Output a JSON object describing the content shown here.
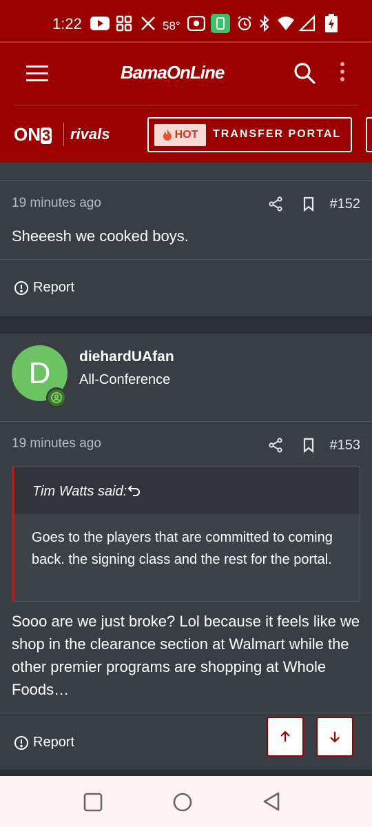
{
  "status_bar": {
    "time": "1:22",
    "temperature": "58°",
    "icons": [
      "youtube-icon",
      "apps-icon",
      "x-icon",
      "hotspot-icon",
      "battery-saver-icon",
      "alarm-icon",
      "bluetooth-icon",
      "wifi-icon",
      "signal-icon",
      "battery-icon"
    ]
  },
  "header": {
    "site_name": "BamaOnLine",
    "on3_label": "ON",
    "on3_digit": "3",
    "rivals_label": "rivals",
    "hot_label": "HOT",
    "transfer_portal_label": "TRANSFER PORTAL",
    "brand_color": "#9b0000"
  },
  "posts": [
    {
      "time": "19 minutes ago",
      "number": "#152",
      "body": "Sheeesh we cooked boys.",
      "report_label": "Report"
    },
    {
      "author": "diehardUAfan",
      "rank": "All-Conference",
      "avatar_letter": "D",
      "avatar_color": "#6dc264",
      "time": "19 minutes ago",
      "number": "#153",
      "quote": {
        "author": "Tim Watts said:",
        "text": "Goes to the players that are committed to coming back. the signing class and the rest for the portal."
      },
      "body": "Sooo are we just broke? Lol because it feels like we shop in the clearance section at Walmart while the other premier programs are shopping at Whole Foods…",
      "report_label": "Report"
    }
  ],
  "nav_bar": {
    "buttons": [
      "recents-button",
      "home-button",
      "back-button"
    ]
  }
}
